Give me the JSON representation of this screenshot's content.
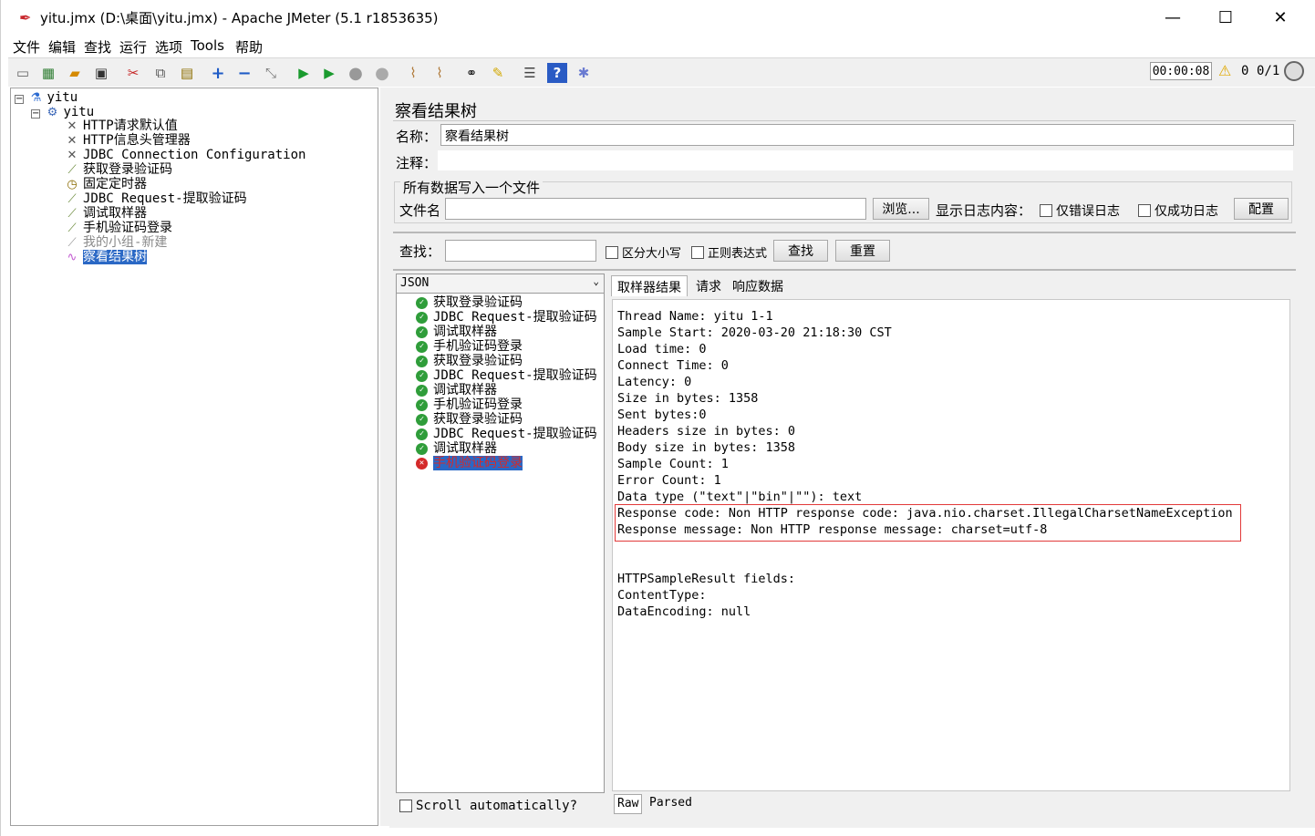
{
  "window": {
    "title": "yitu.jmx (D:\\桌面\\yitu.jmx) - Apache JMeter (5.1 r1853635)",
    "minimize": "—",
    "maximize": "☐",
    "close": "✕"
  },
  "menu": [
    "文件",
    "编辑",
    "查找",
    "运行",
    "选项",
    "Tools",
    "帮助"
  ],
  "toolbar": {
    "timer": "00:00:08",
    "warning_count": "0",
    "threads": "0/1"
  },
  "tree": {
    "root": "yitu",
    "thread_group": "yitu",
    "items": [
      "HTTP请求默认值",
      "HTTP信息头管理器",
      "JDBC Connection Configuration",
      "获取登录验证码",
      "固定定时器",
      "JDBC Request-提取验证码",
      "调试取样器",
      "手机验证码登录",
      "我的小组-新建",
      "察看结果树"
    ]
  },
  "panel": {
    "title": "察看结果树",
    "name_label": "名称：",
    "name_value": "察看结果树",
    "comment_label": "注释：",
    "file_section_title": "所有数据写入一个文件",
    "filename_label": "文件名",
    "browse_button": "浏览...",
    "log_label": "显示日志内容：",
    "errors_only": "仅错误日志",
    "success_only": "仅成功日志",
    "config_button": "配置",
    "search_label": "查找：",
    "case_sensitive": "区分大小写",
    "regex": "正则表达式",
    "find_button": "查找",
    "reset_button": "重置"
  },
  "results": {
    "renderer": "JSON",
    "items": [
      {
        "label": "获取登录验证码",
        "status": "ok"
      },
      {
        "label": "JDBC Request-提取验证码",
        "status": "ok"
      },
      {
        "label": "调试取样器",
        "status": "ok"
      },
      {
        "label": "手机验证码登录",
        "status": "ok"
      },
      {
        "label": "获取登录验证码",
        "status": "ok"
      },
      {
        "label": "JDBC Request-提取验证码",
        "status": "ok"
      },
      {
        "label": "调试取样器",
        "status": "ok"
      },
      {
        "label": "手机验证码登录",
        "status": "ok"
      },
      {
        "label": "获取登录验证码",
        "status": "ok"
      },
      {
        "label": "JDBC Request-提取验证码",
        "status": "ok"
      },
      {
        "label": "调试取样器",
        "status": "ok"
      },
      {
        "label": "手机验证码登录",
        "status": "error"
      }
    ],
    "scroll_label": "Scroll automatically?"
  },
  "detail": {
    "tabs": [
      "取样器结果",
      "请求",
      "响应数据"
    ],
    "lines": [
      "Thread Name: yitu 1-1",
      "Sample Start: 2020-03-20 21:18:30 CST",
      "Load time: 0",
      "Connect Time: 0",
      "Latency: 0",
      "Size in bytes: 1358",
      "Sent bytes:0",
      "Headers size in bytes: 0",
      "Body size in bytes: 1358",
      "Sample Count: 1",
      "Error Count: 1",
      "Data type (\"text\"|\"bin\"|\"\"): text",
      "Response code: Non HTTP response code: java.nio.charset.IllegalCharsetNameException",
      "Response message: Non HTTP response message: charset=utf-8",
      "",
      "",
      "HTTPSampleResult fields:",
      "ContentType:",
      "DataEncoding: null"
    ],
    "bottom_tabs": [
      "Raw",
      "Parsed"
    ]
  }
}
